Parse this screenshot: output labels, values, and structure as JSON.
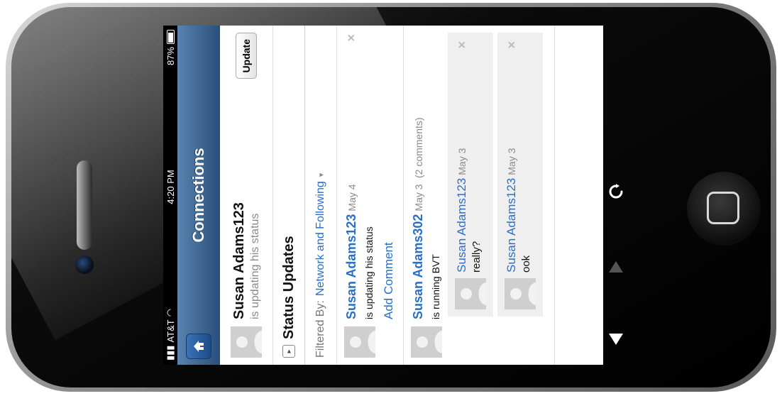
{
  "status_bar": {
    "carrier": "AT&T",
    "time": "4:20 PM",
    "battery": "87%"
  },
  "nav": {
    "title": "Connections"
  },
  "user": {
    "name": "Susan Adams123",
    "status": "is updating his status",
    "update_label": "Update"
  },
  "section": {
    "toggle": "▸",
    "title": "Status Updates"
  },
  "filter": {
    "label": "Filtered By:",
    "value": "Network and Following",
    "caret": "▾"
  },
  "posts": [
    {
      "name": "Susan Adams123",
      "date": "May 4",
      "text": "is updating his status",
      "add_comment": "Add Comment",
      "close": "×"
    },
    {
      "name": "Susan Adams302",
      "date": "May 3",
      "comments_count": "(2 comments)",
      "text": "is running BVT",
      "close": "×",
      "comments": [
        {
          "name": "Susan Adams123",
          "date": "May 3",
          "text": "really?",
          "close": "×"
        },
        {
          "name": "Susan Adams123",
          "date": "May 3",
          "text": "ook",
          "close": "×"
        }
      ]
    }
  ],
  "controls": {
    "refresh_icon": "refresh-icon",
    "up_icon": "up-arrow-icon",
    "down_icon": "down-arrow-icon"
  }
}
